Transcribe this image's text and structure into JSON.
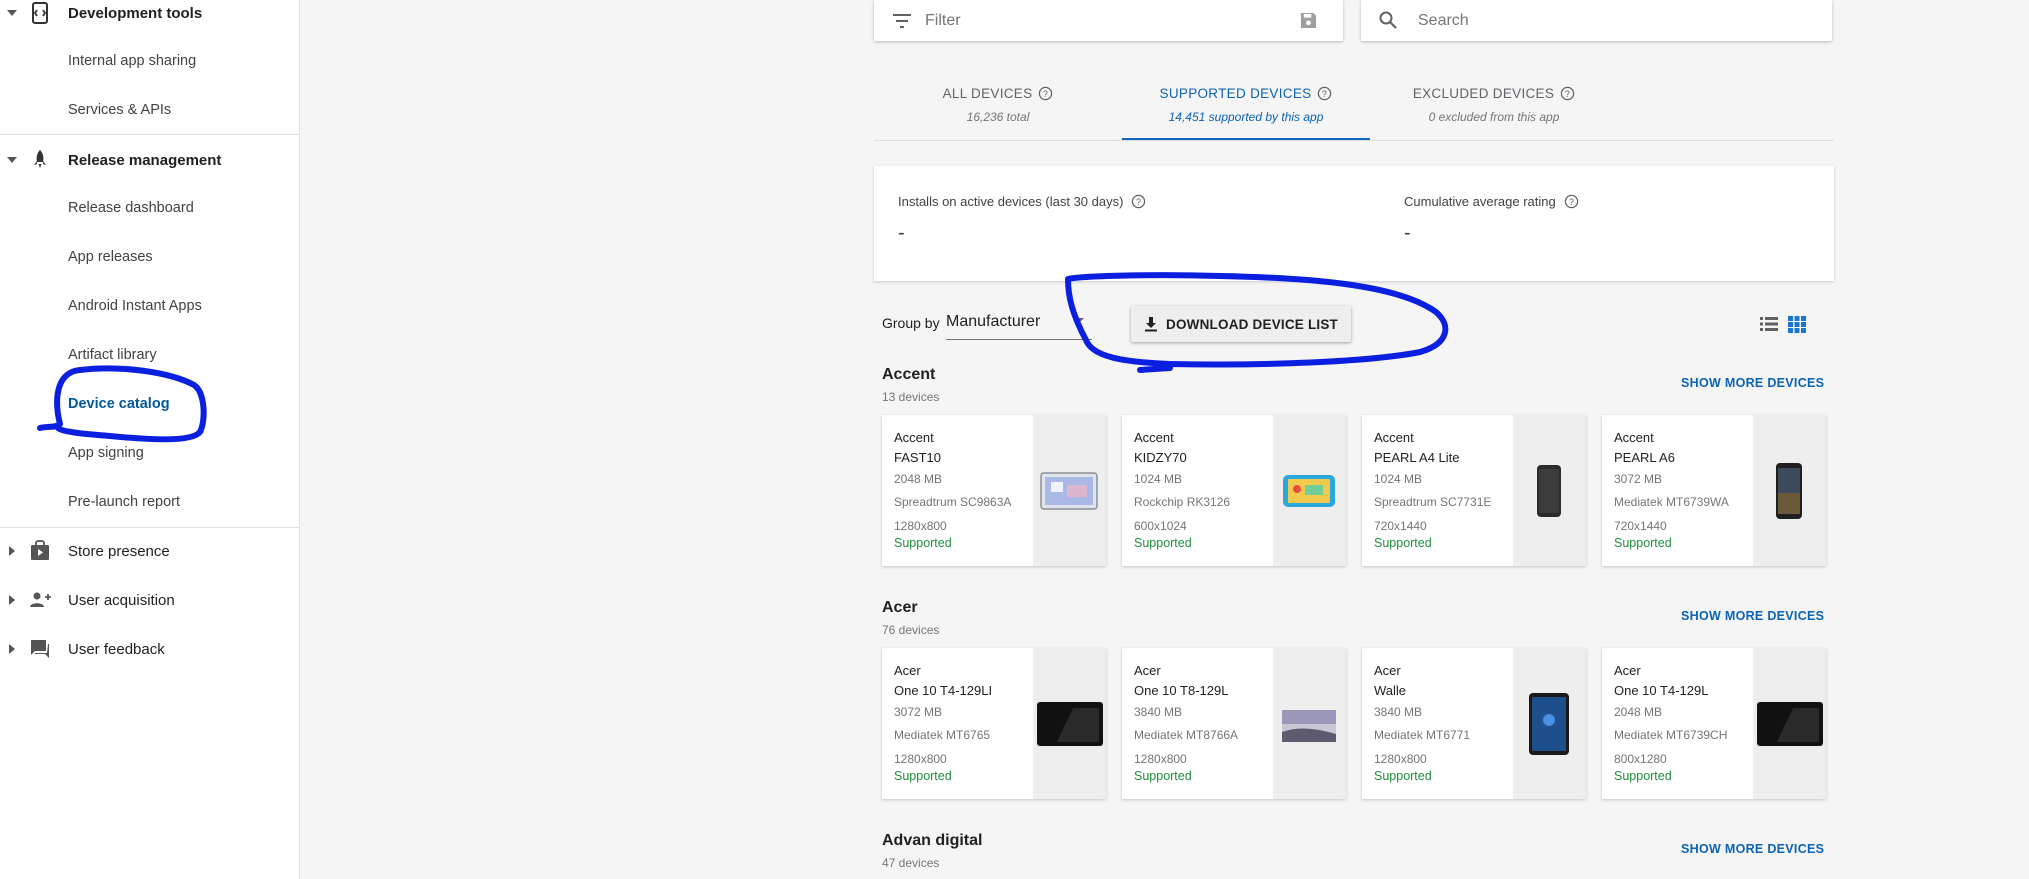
{
  "sidebar": {
    "sections": [
      {
        "label": "Development tools",
        "expanded": true,
        "icon": "dev-tools-icon",
        "items": [
          "Internal app sharing",
          "Services & APIs"
        ]
      },
      {
        "label": "Release management",
        "expanded": true,
        "icon": "rocket-icon",
        "items": [
          "Release dashboard",
          "App releases",
          "Android Instant Apps",
          "Artifact library",
          "Device catalog",
          "App signing",
          "Pre-launch report"
        ]
      },
      {
        "label": "Store presence",
        "expanded": false,
        "icon": "store-icon"
      },
      {
        "label": "User acquisition",
        "expanded": false,
        "icon": "user-add-icon"
      },
      {
        "label": "User feedback",
        "expanded": false,
        "icon": "feedback-icon"
      }
    ],
    "active_item": "Device catalog"
  },
  "filter": {
    "placeholder": "Filter"
  },
  "search": {
    "placeholder": "Search"
  },
  "tabs": [
    {
      "label": "ALL DEVICES",
      "sub": "16,236 total",
      "active": false
    },
    {
      "label": "SUPPORTED DEVICES",
      "sub": "14,451 supported by this app",
      "active": true
    },
    {
      "label": "EXCLUDED DEVICES",
      "sub": "0 excluded from this app",
      "active": false
    }
  ],
  "stats": {
    "installs_label": "Installs on active devices (last 30 days)",
    "installs_value": "-",
    "rating_label": "Cumulative average rating",
    "rating_value": "-"
  },
  "toolbar": {
    "group_by_label": "Group by",
    "group_by_value": "Manufacturer",
    "download_label": "DOWNLOAD DEVICE LIST"
  },
  "show_more_label": "SHOW MORE DEVICES",
  "groups": [
    {
      "name": "Accent",
      "count": "13 devices",
      "devices": [
        {
          "brand": "Accent",
          "model": "FAST10",
          "ram": "2048 MB",
          "soc": "Spreadtrum SC9863A",
          "res": "1280x800",
          "status": "Supported",
          "image": "tablet-blue"
        },
        {
          "brand": "Accent",
          "model": "KIDZY70",
          "ram": "1024 MB",
          "soc": "Rockchip RK3126",
          "res": "600x1024",
          "status": "Supported",
          "image": "kids-tablet"
        },
        {
          "brand": "Accent",
          "model": "PEARL A4 Lite",
          "ram": "1024 MB",
          "soc": "Spreadtrum SC7731E",
          "res": "720x1440",
          "status": "Supported",
          "image": "phone-black"
        },
        {
          "brand": "Accent",
          "model": "PEARL A6",
          "ram": "3072 MB",
          "soc": "Mediatek MT6739WA",
          "res": "720x1440",
          "status": "Supported",
          "image": "phone-screen"
        }
      ]
    },
    {
      "name": "Acer",
      "count": "76 devices",
      "devices": [
        {
          "brand": "Acer",
          "model": "One 10 T4-129LI",
          "ram": "3072 MB",
          "soc": "Mediatek MT6765",
          "res": "1280x800",
          "status": "Supported",
          "image": "tablet-black"
        },
        {
          "brand": "Acer",
          "model": "One 10 T8-129L",
          "ram": "3840 MB",
          "soc": "Mediatek MT8766A",
          "res": "1280x800",
          "status": "Supported",
          "image": "tablet-landscape"
        },
        {
          "brand": "Acer",
          "model": "Walle",
          "ram": "3840 MB",
          "soc": "Mediatek MT6771",
          "res": "1280x800",
          "status": "Supported",
          "image": "tablet-portrait"
        },
        {
          "brand": "Acer",
          "model": "One 10 T4-129L",
          "ram": "2048 MB",
          "soc": "Mediatek MT6739CH",
          "res": "800x1280",
          "status": "Supported",
          "image": "tablet-black"
        }
      ]
    },
    {
      "name": "Advan digital",
      "count": "47 devices",
      "devices": []
    }
  ],
  "colors": {
    "accent": "#0b63b6",
    "supported": "#1e8e3e",
    "annotation": "#0a1fe0"
  }
}
